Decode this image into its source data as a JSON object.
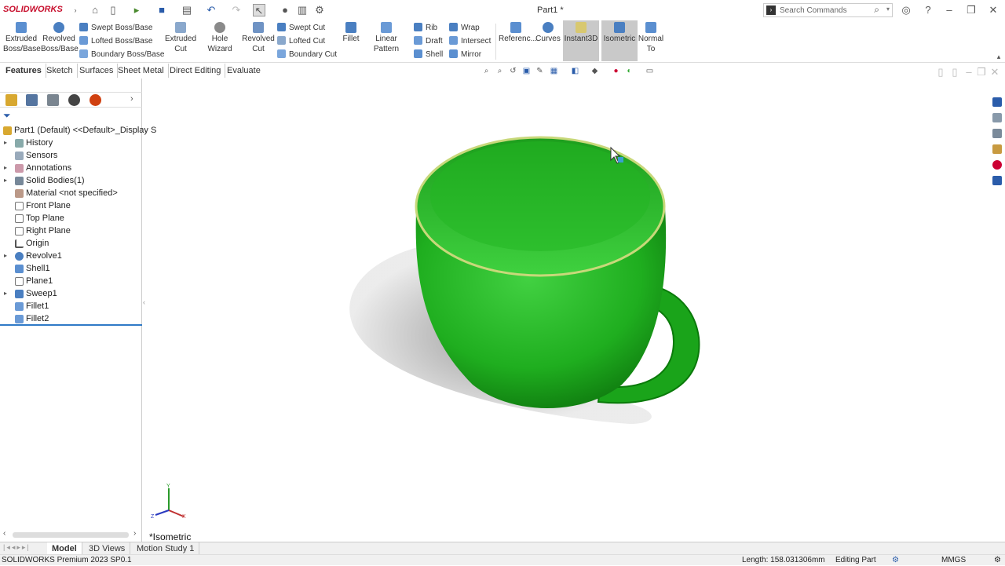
{
  "app": {
    "logo": "SOLIDWORKS",
    "doc_title": "Part1 *"
  },
  "search": {
    "placeholder": "Search Commands"
  },
  "commands": {
    "extruded_boss": "Extruded Boss/Base",
    "revolved_boss": "Revolved Boss/Base",
    "swept_boss": "Swept Boss/Base",
    "lofted_boss": "Lofted Boss/Base",
    "boundary_boss": "Boundary Boss/Base",
    "extruded_cut": "Extruded Cut",
    "hole_wizard": "Hole Wizard",
    "revolved_cut": "Revolved Cut",
    "swept_cut": "Swept Cut",
    "lofted_cut": "Lofted Cut",
    "boundary_cut": "Boundary Cut",
    "fillet": "Fillet",
    "linear_pattern": "Linear Pattern",
    "rib": "Rib",
    "draft": "Draft",
    "shell": "Shell",
    "wrap": "Wrap",
    "intersect": "Intersect",
    "mirror": "Mirror",
    "reference": "Referenc...",
    "curves": "Curves",
    "instant3d": "Instant3D",
    "isometric": "Isometric",
    "normal_to": "Normal To"
  },
  "tabs": [
    "Features",
    "Sketch",
    "Surfaces",
    "Sheet Metal",
    "Direct Editing",
    "Evaluate"
  ],
  "tree": {
    "root": "Part1 (Default) <<Default>_Display S",
    "items": [
      "History",
      "Sensors",
      "Annotations",
      "Solid Bodies(1)",
      "Material <not specified>",
      "Front Plane",
      "Top Plane",
      "Right Plane",
      "Origin",
      "Revolve1",
      "Shell1",
      "Plane1",
      "Sweep1",
      "Fillet1",
      "Fillet2"
    ]
  },
  "viewport": {
    "view_label": "*Isometric",
    "model_color": "#1ea81e"
  },
  "bottom_tabs": [
    "Model",
    "3D Views",
    "Motion Study 1"
  ],
  "status": {
    "product": "SOLIDWORKS Premium 2023 SP0.1",
    "length": "Length: 158.031306mm",
    "mode": "Editing Part",
    "units": "MMGS"
  }
}
